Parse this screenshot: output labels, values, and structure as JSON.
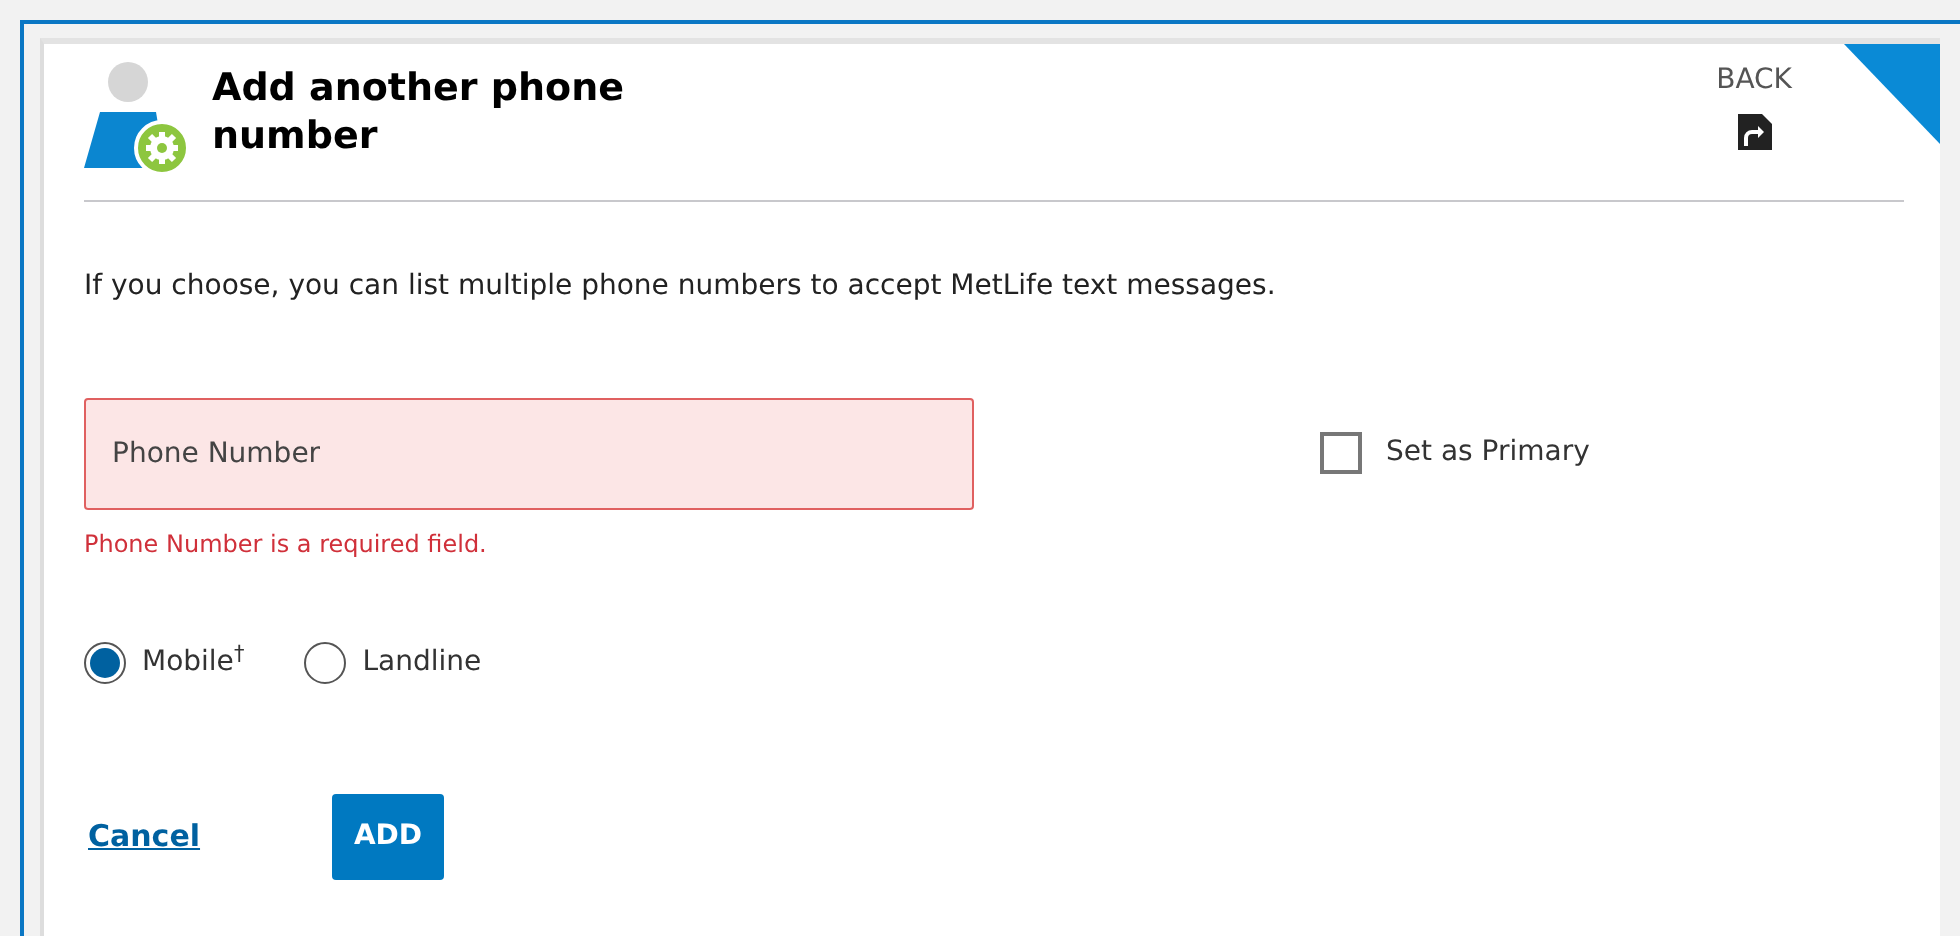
{
  "header": {
    "title": "Add another phone number",
    "back_label": "BACK"
  },
  "intro": "If you choose, you can list multiple phone numbers to accept MetLife text messages.",
  "phone_field": {
    "placeholder": "Phone Number",
    "invalid": true,
    "error": "Phone Number is a required field."
  },
  "primary_checkbox": {
    "label": "Set as Primary",
    "checked": false
  },
  "phone_types": [
    {
      "label": "Mobile$^{†}$",
      "selected": true
    },
    {
      "label": "Landline",
      "selected": false
    }
  ],
  "actions": {
    "cancel": "Cancel",
    "submit": "ADD"
  }
}
